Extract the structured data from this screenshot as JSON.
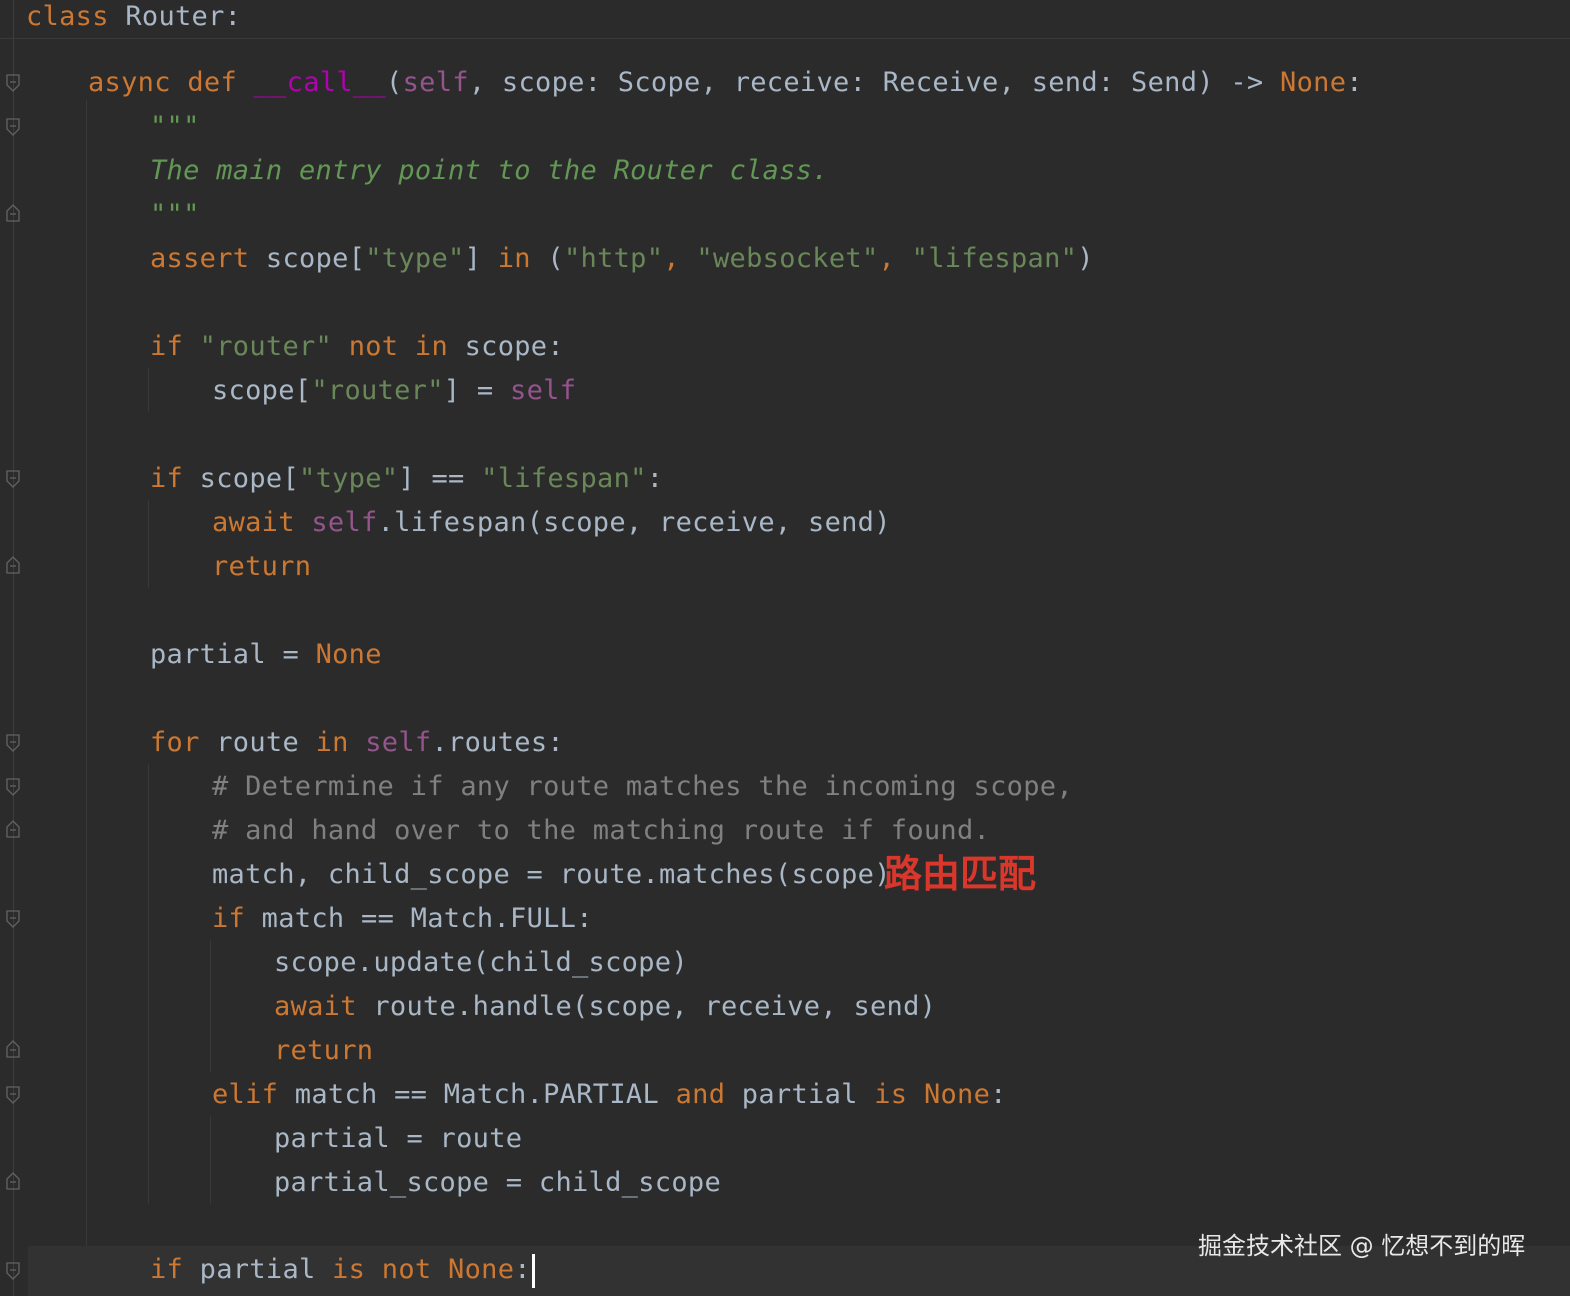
{
  "editor": {
    "lines": {
      "l0": [
        "class",
        " Router:"
      ],
      "l1": [
        "async def ",
        "__call__",
        "(",
        "self",
        ", scope: Scope, receive: Receive, send: Send) -> ",
        "None",
        ":"
      ],
      "l2": [
        "\"\"\""
      ],
      "l3": [
        "The main entry point to the Router class."
      ],
      "l4": [
        "\"\"\""
      ],
      "l5": [
        "assert",
        " scope[",
        "\"type\"",
        "] ",
        "in",
        " (",
        "\"http\"",
        ", ",
        "\"websocket\"",
        ", ",
        "\"lifespan\"",
        ")"
      ],
      "l6": [
        "if ",
        "\"router\"",
        " ",
        "not in",
        " scope:"
      ],
      "l7": [
        "scope[",
        "\"router\"",
        "] = ",
        "self"
      ],
      "l8": [
        "if",
        " scope[",
        "\"type\"",
        "] == ",
        "\"lifespan\"",
        ":"
      ],
      "l9": [
        "await ",
        "self",
        ".lifespan(scope, receive, send)"
      ],
      "l10": [
        "return"
      ],
      "l11": [
        "partial = ",
        "None"
      ],
      "l12": [
        "for",
        " route ",
        "in",
        " ",
        "self",
        ".routes:"
      ],
      "l13": [
        "# Determine if any route matches the incoming scope,"
      ],
      "l14": [
        "# and hand over to the matching route if found."
      ],
      "l15": [
        "match, child_scope = route.matches(scope)"
      ],
      "l16": [
        "if",
        " match == Match.FULL:"
      ],
      "l17": [
        "scope.update(child_scope)"
      ],
      "l18": [
        "await",
        " route.handle(scope, receive, send)"
      ],
      "l19": [
        "return"
      ],
      "l20": [
        "elif",
        " match == Match.PARTIAL ",
        "and",
        " partial ",
        "is",
        " ",
        "None",
        ":"
      ],
      "l21": [
        "partial = route"
      ],
      "l22": [
        "partial_scope = child_scope"
      ],
      "l23": [
        "if",
        " partial ",
        "is not",
        " ",
        "None",
        ":"
      ]
    }
  },
  "annotation": "路由匹配",
  "watermark": "掘金技术社区 @ 忆想不到的晖",
  "colors": {
    "background": "#2b2b2b",
    "keyword": "#cc7832",
    "self": "#94558d",
    "string": "#6a8759",
    "docstring": "#629755",
    "comment": "#808080",
    "magic": "#b200b2",
    "text": "#a9b7c6",
    "annotation": "#d9372b"
  }
}
